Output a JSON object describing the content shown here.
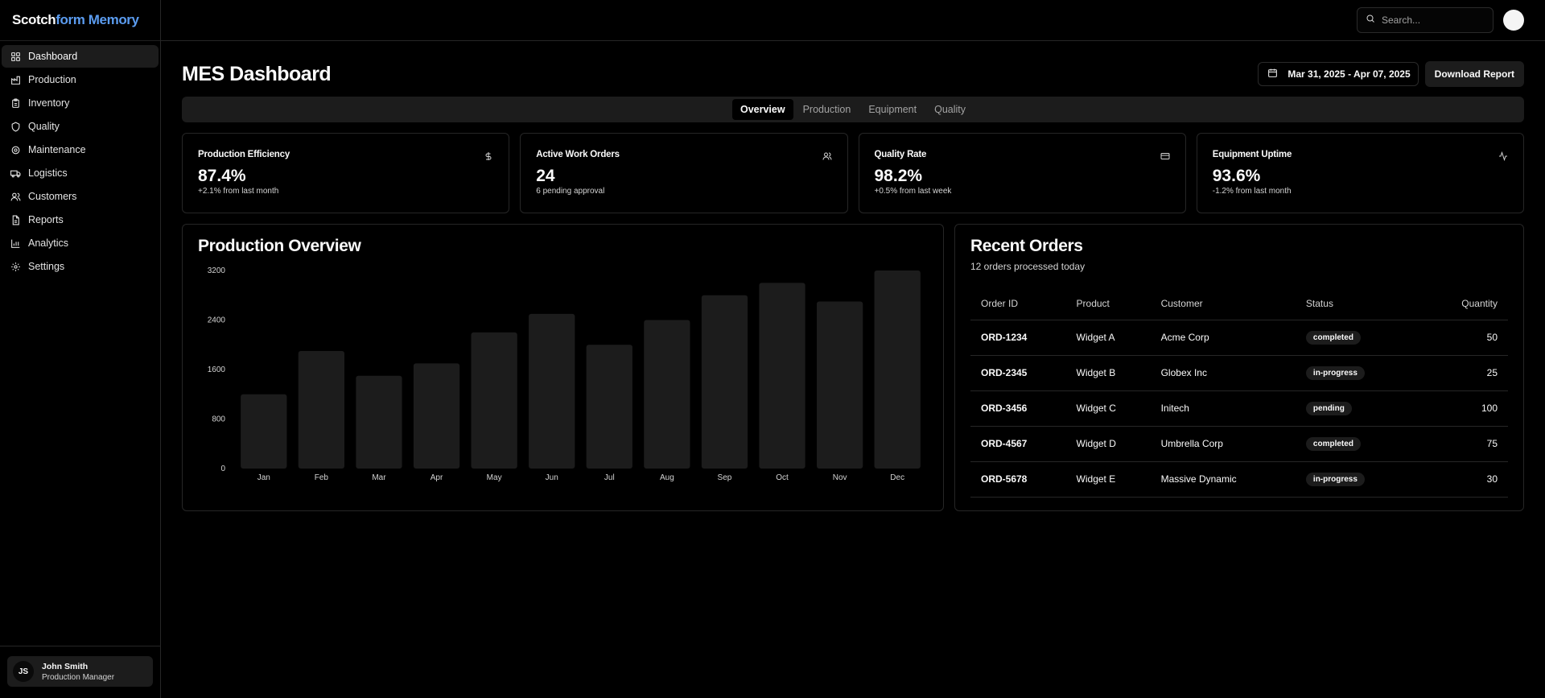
{
  "brand": {
    "part1": "Scotch",
    "part2": "form Memory"
  },
  "sidebar": {
    "items": [
      {
        "label": "Dashboard",
        "icon": "grid-icon"
      },
      {
        "label": "Production",
        "icon": "factory-icon"
      },
      {
        "label": "Inventory",
        "icon": "clipboard-icon"
      },
      {
        "label": "Quality",
        "icon": "shield-icon"
      },
      {
        "label": "Maintenance",
        "icon": "settings-icon"
      },
      {
        "label": "Logistics",
        "icon": "truck-icon"
      },
      {
        "label": "Customers",
        "icon": "users-icon"
      },
      {
        "label": "Reports",
        "icon": "file-icon"
      },
      {
        "label": "Analytics",
        "icon": "bar-chart-icon"
      },
      {
        "label": "Settings",
        "icon": "gear-icon"
      }
    ],
    "user": {
      "initials": "JS",
      "name": "John Smith",
      "role": "Production Manager"
    }
  },
  "topbar": {
    "search_placeholder": "Search..."
  },
  "header": {
    "title": "MES Dashboard",
    "date_range": "Mar 31, 2025 - Apr 07, 2025",
    "download_label": "Download Report"
  },
  "tabs": [
    "Overview",
    "Production",
    "Equipment",
    "Quality"
  ],
  "stats": [
    {
      "title": "Production Efficiency",
      "value": "87.4%",
      "sub": "+2.1% from last month",
      "icon": "dollar-icon"
    },
    {
      "title": "Active Work Orders",
      "value": "24",
      "sub": "6 pending approval",
      "icon": "users-icon"
    },
    {
      "title": "Quality Rate",
      "value": "98.2%",
      "sub": "+0.5% from last week",
      "icon": "credit-card-icon"
    },
    {
      "title": "Equipment Uptime",
      "value": "93.6%",
      "sub": "-1.2% from last month",
      "icon": "activity-icon"
    }
  ],
  "overview": {
    "title": "Production Overview"
  },
  "chart_data": {
    "type": "bar",
    "categories": [
      "Jan",
      "Feb",
      "Mar",
      "Apr",
      "May",
      "Jun",
      "Jul",
      "Aug",
      "Sep",
      "Oct",
      "Nov",
      "Dec"
    ],
    "values": [
      1200,
      1900,
      1500,
      1700,
      2200,
      2500,
      2000,
      2400,
      2800,
      3000,
      2700,
      3200
    ],
    "yticks": [
      0,
      800,
      1600,
      2400,
      3200
    ],
    "ylim": [
      0,
      3200
    ],
    "bar_color": "#1c1c1c",
    "grid": false
  },
  "orders": {
    "title": "Recent Orders",
    "subtitle": "12 orders processed today",
    "columns": [
      "Order ID",
      "Product",
      "Customer",
      "Status",
      "Quantity"
    ],
    "rows": [
      {
        "id": "ORD-1234",
        "product": "Widget A",
        "customer": "Acme Corp",
        "status": "completed",
        "qty": "50"
      },
      {
        "id": "ORD-2345",
        "product": "Widget B",
        "customer": "Globex Inc",
        "status": "in-progress",
        "qty": "25"
      },
      {
        "id": "ORD-3456",
        "product": "Widget C",
        "customer": "Initech",
        "status": "pending",
        "qty": "100"
      },
      {
        "id": "ORD-4567",
        "product": "Widget D",
        "customer": "Umbrella Corp",
        "status": "completed",
        "qty": "75"
      },
      {
        "id": "ORD-5678",
        "product": "Widget E",
        "customer": "Massive Dynamic",
        "status": "in-progress",
        "qty": "30"
      }
    ]
  }
}
